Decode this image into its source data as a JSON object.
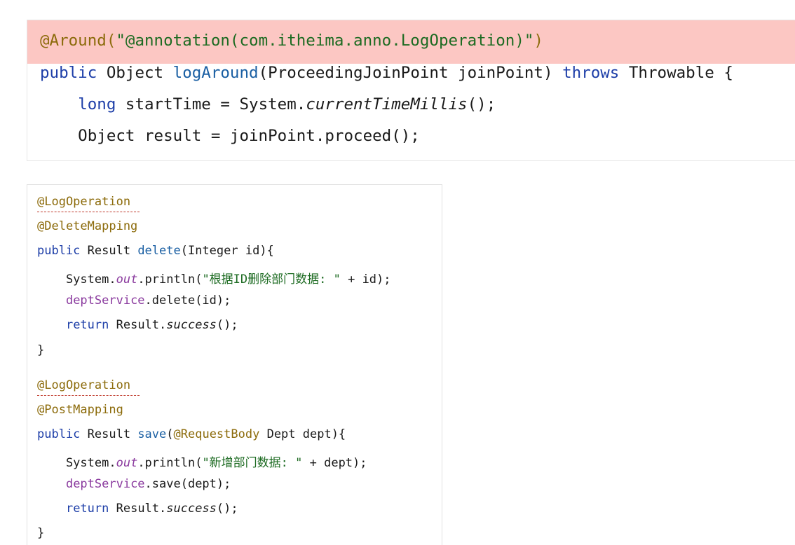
{
  "top_code": {
    "lines": [
      [
        "@Around(",
        "\"@annotation(com.itheima.anno.LogOperation)\"",
        ")"
      ],
      [
        "public",
        " Object ",
        "logAround",
        "(ProceedingJoinPoint joinPoint) ",
        "throws",
        " Throwable {"
      ],
      [
        "    ",
        "long",
        " startTime = System.",
        "currentTimeMillis",
        "();"
      ],
      [
        "    Object result = joinPoint.proceed();"
      ]
    ]
  },
  "bottom_code": {
    "lines": [
      [
        "@LogOperation"
      ],
      [
        "@DeleteMapping"
      ],
      [
        "public",
        " Result ",
        "delete",
        "(Integer id){"
      ],
      [
        "    System.",
        "out",
        ".println(",
        "\"根据ID删除部门数据: \"",
        " + id);"
      ],
      [
        "    ",
        "deptService",
        ".delete(id);"
      ],
      [
        "    ",
        "return",
        " Result.",
        "success",
        "();"
      ],
      [
        "}"
      ],
      [
        "@LogOperation"
      ],
      [
        "@PostMapping"
      ],
      [
        "public",
        " Result ",
        "save",
        "(",
        "@RequestBody",
        " Dept dept){"
      ],
      [
        "    System.",
        "out",
        ".println(",
        "\"新增部门数据: \"",
        " + dept);"
      ],
      [
        "    ",
        "deptService",
        ".save(dept);"
      ],
      [
        "    ",
        "return",
        " Result.",
        "success",
        "();"
      ],
      [
        "}"
      ]
    ]
  },
  "colors": {
    "highlight_line": "#fcc7c3",
    "annotation": "#8c6b0b",
    "keyword": "#1d3ea8",
    "string": "#1d6b22",
    "field": "#8a3a9e"
  }
}
